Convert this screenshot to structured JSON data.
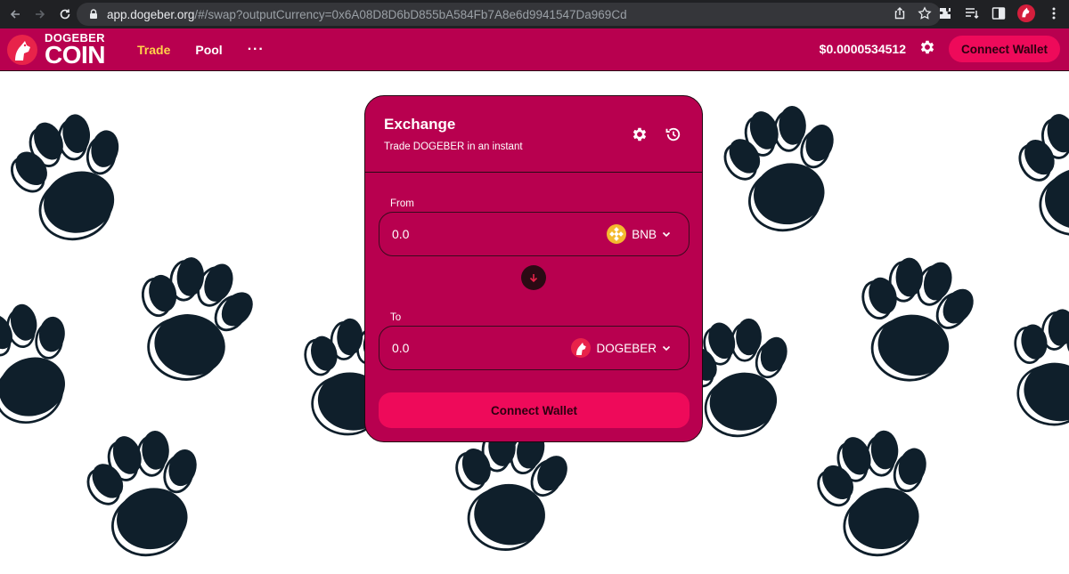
{
  "browser": {
    "url_host": "app.dogeber.org",
    "url_path": "/#/swap?outputCurrency=0x6A08D8D6bD855bA584Fb7A8e6d9941547Da969Cd"
  },
  "header": {
    "logo_line1": "DOGEBER",
    "logo_line2": "COIN",
    "nav": [
      {
        "label": "Trade",
        "active": true
      },
      {
        "label": "Pool",
        "active": false
      }
    ],
    "more": "···",
    "price": "$0.0000534512",
    "connect_label": "Connect Wallet"
  },
  "exchange": {
    "title": "Exchange",
    "subtitle": "Trade DOGEBER in an instant",
    "from_label": "From",
    "from_amount": "0.0",
    "from_token": "BNB",
    "to_label": "To",
    "to_amount": "0.0",
    "to_token": "DOGEBER",
    "connect_label": "Connect Wallet"
  },
  "colors": {
    "brand": "#b8004f",
    "button": "#ee0a5a",
    "active_nav": "#ffd24a",
    "paw": "#0f1f2b"
  },
  "icons": {
    "settings": "gear-icon",
    "history": "history-icon",
    "swap": "arrow-down-icon",
    "chevron": "chevron-down-icon"
  }
}
